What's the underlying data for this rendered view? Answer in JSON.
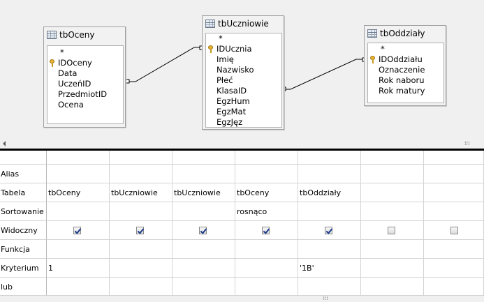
{
  "tables": {
    "oceny": {
      "title": "tbOceny",
      "fields": [
        "*",
        "IDOceny",
        "Data",
        "UczeńID",
        "PrzedmiotID",
        "Ocena"
      ],
      "key_field": "IDOceny"
    },
    "uczniowie": {
      "title": "tbUczniowie",
      "fields": [
        "*",
        "IDUcznia",
        "Imię",
        "Nazwisko",
        "Płeć",
        "KlasaID",
        "EgzHum",
        "EgzMat",
        "EgzJęz"
      ],
      "key_field": "IDUcznia"
    },
    "oddzialy": {
      "title": "tbOddziały",
      "fields": [
        "*",
        "IDOddziału",
        "Oznaczenie",
        "Rok naboru",
        "Rok matury"
      ],
      "key_field": "IDOddziału"
    }
  },
  "icons": {
    "table": "table-icon",
    "primary_key": "key-icon",
    "checkbox": "checkbox-icon"
  },
  "grid": {
    "row_labels": {
      "alias": "Alias",
      "tabela": "Tabela",
      "sortowanie": "Sortowanie",
      "widoczny": "Widoczny",
      "funkcja": "Funkcja",
      "kryterium": "Kryterium",
      "lub": "lub"
    },
    "columns": [
      {
        "tabela": "tbOceny",
        "sortowanie": "",
        "widoczny": true,
        "kryterium": "1"
      },
      {
        "tabela": "tbUczniowie",
        "sortowanie": "",
        "widoczny": true,
        "kryterium": ""
      },
      {
        "tabela": "tbUczniowie",
        "sortowanie": "",
        "widoczny": true,
        "kryterium": ""
      },
      {
        "tabela": "tbOceny",
        "sortowanie": "rosnąco",
        "widoczny": true,
        "kryterium": ""
      },
      {
        "tabela": "tbOddziały",
        "sortowanie": "",
        "widoczny": true,
        "kryterium": "'1B'"
      },
      {
        "tabela": "",
        "sortowanie": "",
        "widoczny": false,
        "kryterium": ""
      },
      {
        "tabela": "",
        "sortowanie": "",
        "widoczny": false,
        "kryterium": ""
      }
    ]
  },
  "colors": {
    "canvas_bg": "#f0f0f0",
    "grid_line": "#d4d4d4",
    "splitter": "#000000",
    "checkmark": "#1b3a8a",
    "key": "#e8b830"
  }
}
